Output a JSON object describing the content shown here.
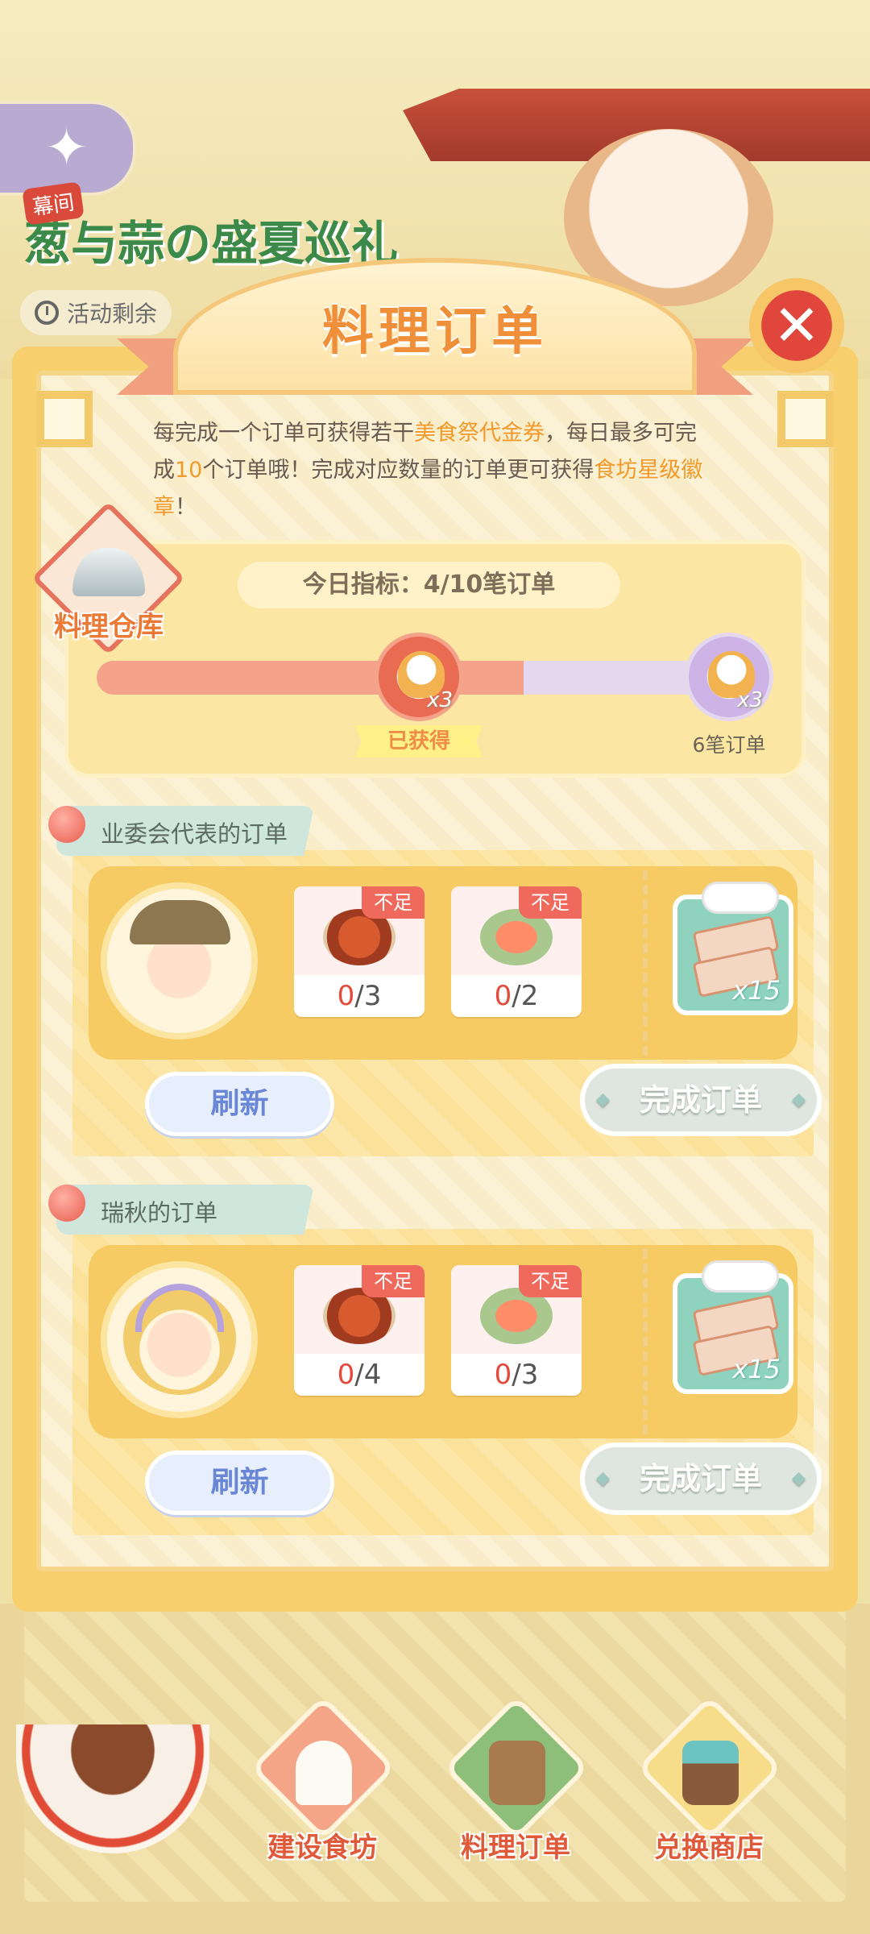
{
  "event": {
    "tag": "幕间",
    "title": "葱与蒜の盛夏巡礼",
    "time_label": "活动剩余"
  },
  "dialog": {
    "title": "料理订单",
    "intro_parts": [
      "每完成一个订单可获得若干",
      "美食祭代金券",
      "，每日最多可完成",
      "10",
      "个订单哦！完成对应数量的订单更可获得",
      "食坊星级徽章",
      "！"
    ],
    "warehouse_label": "料理仓库",
    "daily_goal": "今日指标：4/10笔订单",
    "progress": {
      "completed": 4,
      "total": 10,
      "milestones": [
        {
          "count_label": "x3",
          "status_label": "已获得",
          "at_orders": 3
        },
        {
          "count_label": "x3",
          "status_label": "6笔订单",
          "at_orders": 6
        }
      ]
    }
  },
  "orders": [
    {
      "title": "业委会代表的订单",
      "ingredients": [
        {
          "icon": "braised-stew-icon",
          "tag": "不足",
          "have": "0",
          "need": "/3"
        },
        {
          "icon": "shrimp-salad-icon",
          "tag": "不足",
          "have": "0",
          "need": "/2"
        }
      ],
      "reward": {
        "icon": "coupon-icon",
        "count": "x15"
      },
      "refresh_label": "刷新",
      "complete_label": "完成订单"
    },
    {
      "title": "瑞秋的订单",
      "ingredients": [
        {
          "icon": "braised-stew-icon",
          "tag": "不足",
          "have": "0",
          "need": "/4"
        },
        {
          "icon": "shrimp-salad-icon",
          "tag": "不足",
          "have": "0",
          "need": "/3"
        }
      ],
      "reward": {
        "icon": "coupon-icon",
        "count": "x15"
      },
      "refresh_label": "刷新",
      "complete_label": "完成订单"
    }
  ],
  "nav": [
    {
      "label": "建设食坊",
      "icon": "chef-hat-icon"
    },
    {
      "label": "料理订单",
      "icon": "clipboard-icon"
    },
    {
      "label": "兑换商店",
      "icon": "shop-icon"
    }
  ],
  "colors": {
    "accent_orange": "#f19a2b",
    "progress_fill": "#f4a28a",
    "lack_red": "#ef6a5c",
    "refresh_blue": "#6a86d6"
  }
}
